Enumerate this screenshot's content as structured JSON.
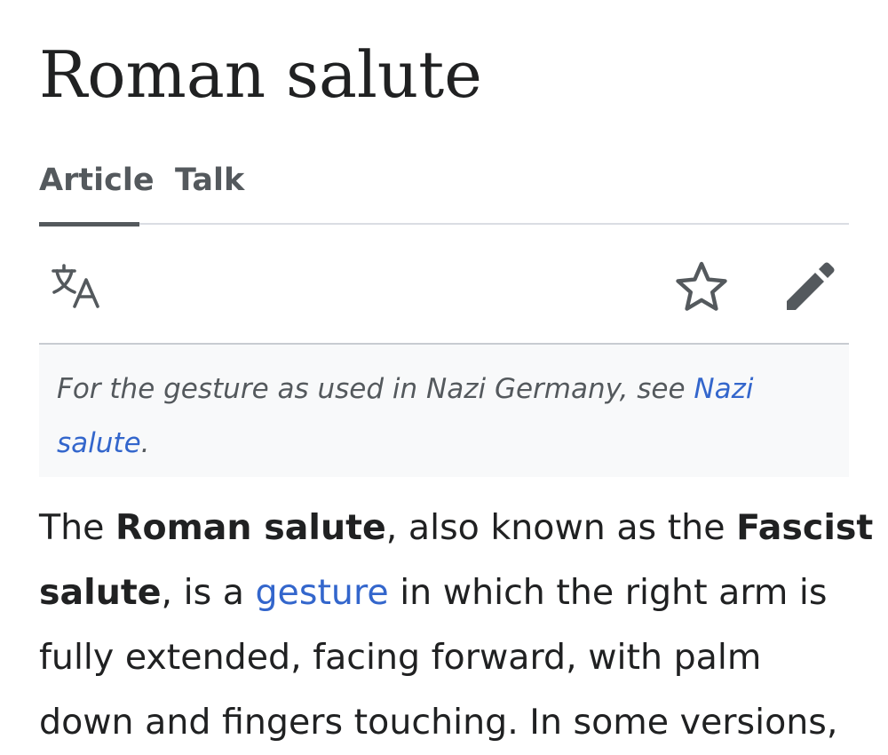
{
  "article": {
    "title": "Roman salute"
  },
  "tabs": [
    {
      "label": "Article",
      "selected": true
    },
    {
      "label": "Talk",
      "selected": false
    }
  ],
  "toolbar": {
    "icons": [
      "language-icon",
      "star-icon",
      "edit-pencil-icon"
    ]
  },
  "hatnote": {
    "text_before": "For the gesture as used in Nazi Germany, see ",
    "link_line1": "Nazi",
    "link_line2": "salute",
    "text_after": "."
  },
  "body": {
    "l1_pre": "The ",
    "l1_bold": "Roman salute",
    "l1_mid": ", also known as the ",
    "l1_bold2": "Fascist",
    "l2_bold": "salute",
    "l2_mid": ", is a ",
    "l2_link": "gesture",
    "l2_post": " in which the right arm is",
    "l3": "fully extended, facing forward, with palm",
    "l4": "down and fingers touching. In some versions,"
  },
  "colors": {
    "text": "#202122",
    "secondary_text": "#54595d",
    "link": "#3366cc",
    "hatnote_background": "#f8f9fa",
    "divider": "#dadde3"
  }
}
